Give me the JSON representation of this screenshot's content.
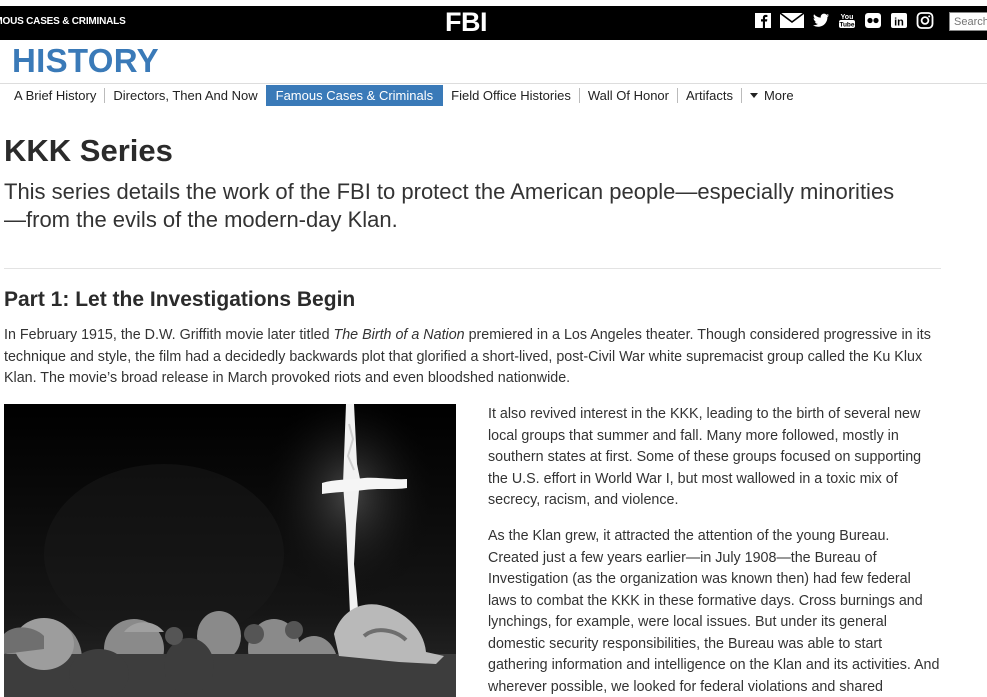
{
  "topbar": {
    "breadcrumb": "FAMOUS CASES & CRIMINALS",
    "logo": "FBI",
    "social_icons": [
      "facebook-icon",
      "email-icon",
      "twitter-icon",
      "youtube-icon",
      "flickr-icon",
      "linkedin-icon",
      "instagram-icon"
    ],
    "youtube_text": "You Tube",
    "linkedin_text": "in",
    "search_placeholder": "Search"
  },
  "section_title": "HISTORY",
  "nav": {
    "items": [
      {
        "label": "A Brief History"
      },
      {
        "label": "Directors, Then And Now"
      },
      {
        "label": "Famous Cases & Criminals",
        "active": true
      },
      {
        "label": "Field Office Histories"
      },
      {
        "label": "Wall Of Honor"
      },
      {
        "label": "Artifacts"
      }
    ],
    "more_label": "More"
  },
  "article": {
    "title": "KKK Series",
    "subtitle": "This series details the work of the FBI to protect the American people—especially minorities—from the evils of the modern-day Klan.",
    "part_title": "Part 1: Let the Investigations Begin",
    "para1_before": "In February 1915, the D.W. Griffith movie later titled ",
    "para1_italic": "The Birth of a Nation",
    "para1_after": " premiered in a Los Angeles theater. Though considered progressive in its technique and style, the film had a decidedly backwards plot that glorified a short-lived, post-Civil War white supremacist group called the Ku Klux Klan. The movie’s broad release in March provoked riots and even bloodshed nationwide.",
    "para2": "It also revived interest in the KKK, leading to the birth of several new local groups that summer and fall. Many more followed, mostly in southern states at first. Some of these groups focused on supporting the U.S. effort in World War I, but most wallowed in a toxic mix of secrecy, racism, and violence.",
    "para3": "As the Klan grew, it attracted the attention of the young Bureau. Created just a few years earlier—in July 1908—the Bureau of Investigation (as the organization was known then) had few federal laws to combat the KKK in these formative days. Cross burnings and lynchings, for example, were local issues. But under its general domestic security responsibilities, the Bureau was able to start gathering information and intelligence on the Klan and its activities. And wherever possible, we looked for federal violations and shared"
  },
  "colors": {
    "accent": "#3a7ab8",
    "topbar": "#000000",
    "text": "#333333"
  }
}
